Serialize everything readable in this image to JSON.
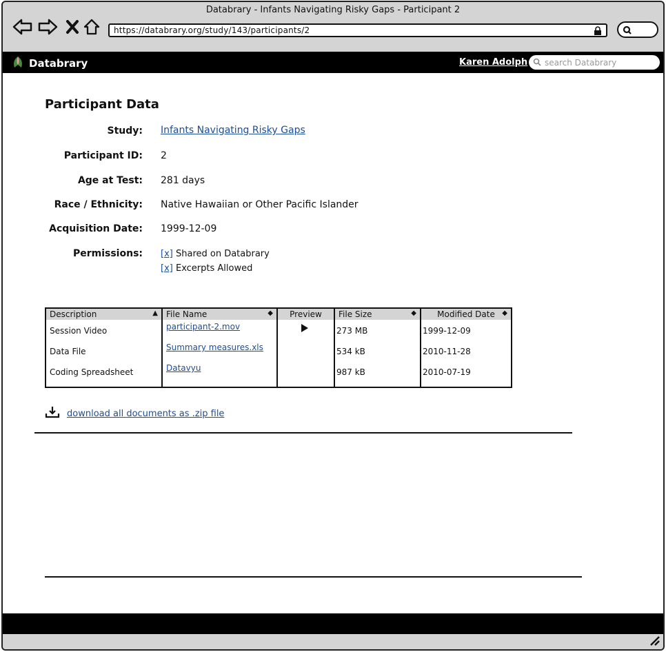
{
  "window": {
    "title": "Databrary - Infants Navigating Risky Gaps - Participant 2"
  },
  "browser": {
    "url": "https://databrary.org/study/143/participants/2",
    "icons": [
      "back-arrow-icon",
      "forward-arrow-icon",
      "close-icon",
      "home-icon",
      "lock-icon",
      "search-icon"
    ]
  },
  "app": {
    "brand": "Databrary",
    "user": "Karen Adolph",
    "search_placeholder": "search Databrary"
  },
  "page": {
    "title": "Participant Data",
    "fields": {
      "study_label": "Study:",
      "study_value": "Infants Navigating Risky Gaps",
      "participant_label": "Participant ID:",
      "participant_value": "2",
      "age_label": "Age at Test:",
      "age_value": "281 days",
      "race_label": "Race / Ethnicity:",
      "race_value": "Native Hawaiian or Other Pacific Islander",
      "acq_label": "Acquisition Date:",
      "acq_value": "1999-12-09",
      "perm_label": "Permissions:"
    },
    "permissions": [
      {
        "checkbox": "[x]",
        "label": "Shared on Databrary"
      },
      {
        "checkbox": "[x]",
        "label": "Excerpts Allowed"
      }
    ]
  },
  "table": {
    "headers": {
      "description": "Description",
      "file_name": "File Name",
      "preview": "Preview",
      "file_size": "File Size",
      "modified": "Modified Date"
    },
    "rows": [
      {
        "description": "Session Video",
        "file_name": "participant-2.mov",
        "preview": "play-icon",
        "file_size": "273 MB",
        "modified": "1999-12-09"
      },
      {
        "description": "Data File",
        "file_name": "Summary measures.xls",
        "preview": "",
        "file_size": "534 kB",
        "modified": "2010-11-28"
      },
      {
        "description": "Coding Spreadsheet",
        "file_name": "Datavyu",
        "preview": "",
        "file_size": "987 kB",
        "modified": "2010-07-19"
      }
    ]
  },
  "download": {
    "label": "download all documents as .zip file",
    "icon": "download-icon"
  }
}
